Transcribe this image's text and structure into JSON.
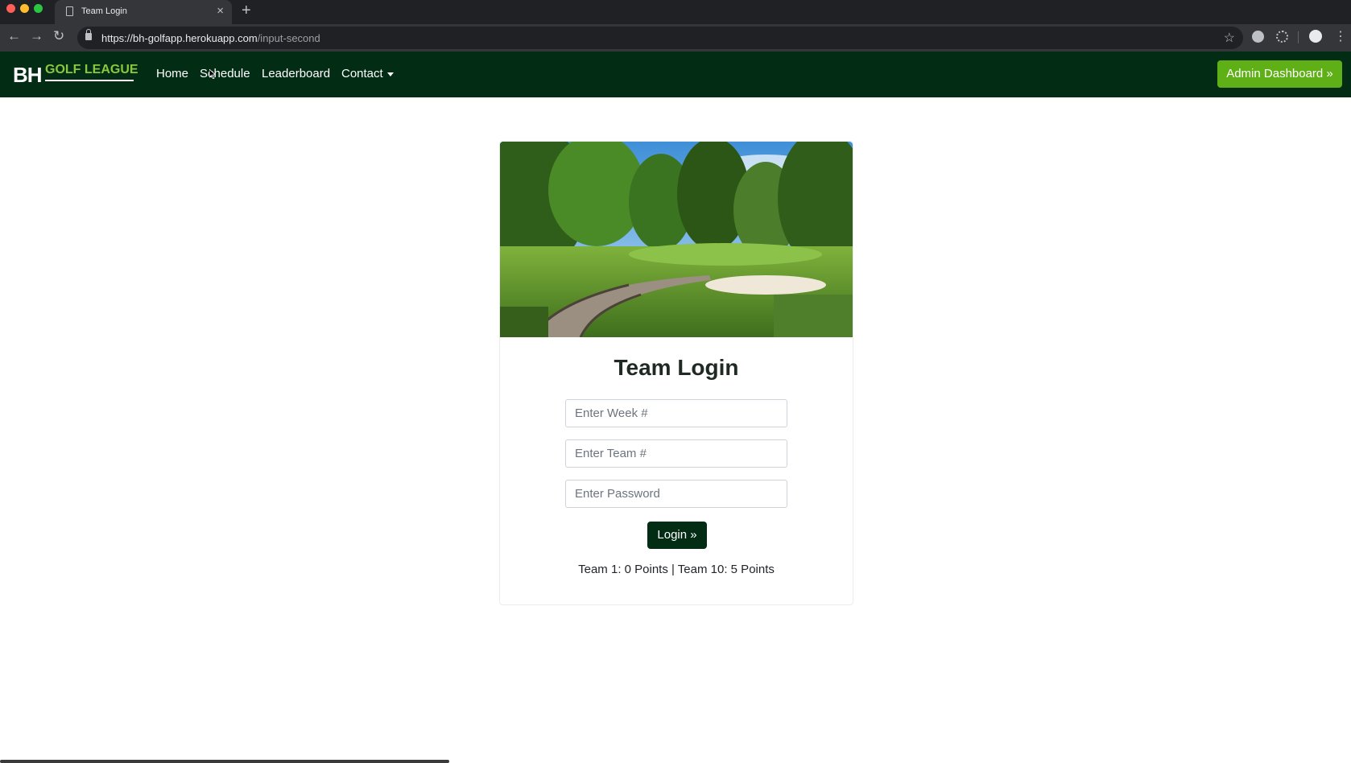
{
  "browser": {
    "tab_title": "Team Login",
    "tab_close": "×",
    "new_tab": "+",
    "url_host": "https://bh-golfapp.herokuapp.com",
    "url_path": "/input-second"
  },
  "navbar": {
    "logo_bh": "BH",
    "logo_text": "GOLF LEAGUE",
    "links": [
      "Home",
      "Schedule",
      "Leaderboard",
      "Contact"
    ],
    "admin_button": "Admin Dashboard »"
  },
  "login": {
    "title": "Team Login",
    "week_placeholder": "Enter Week #",
    "team_placeholder": "Enter Team #",
    "password_placeholder": "Enter Password",
    "button": "Login »",
    "score_text": "Team 1: 0 Points | Team 10: 5 Points"
  },
  "colors": {
    "navbar": "#022d14",
    "admin_button": "#5fb016",
    "logo_accent": "#8dc63f",
    "login_button": "#022d14"
  }
}
